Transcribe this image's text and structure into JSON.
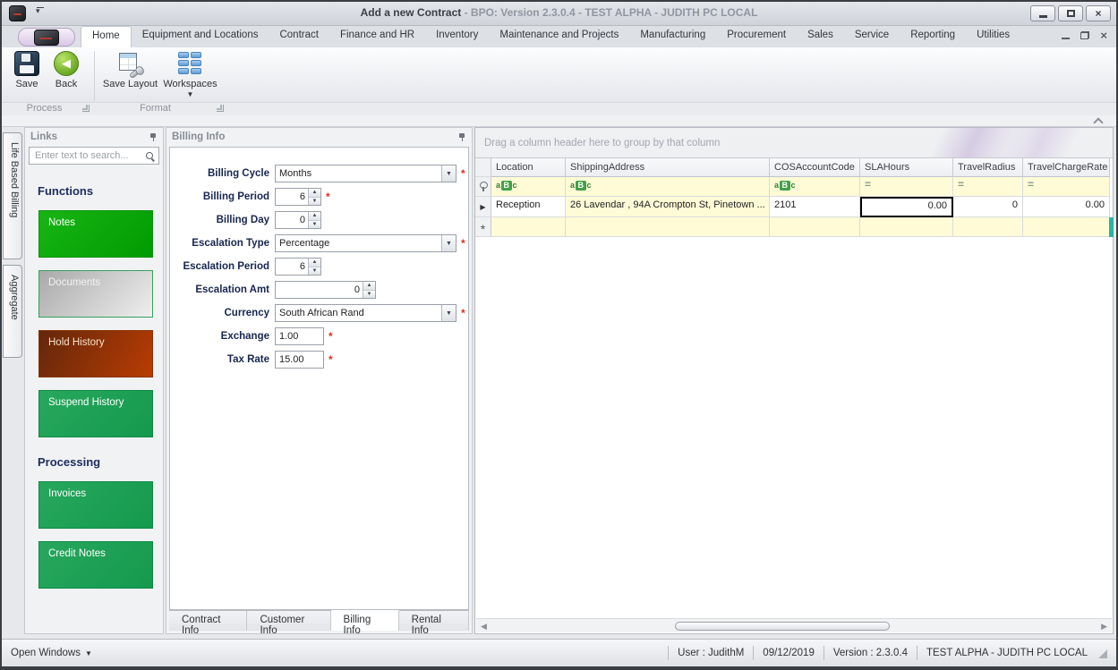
{
  "window": {
    "title_active": "Add a new Contract",
    "title_rest": " - BPO: Version 2.3.0.4 - TEST ALPHA - JUDITH PC LOCAL"
  },
  "ribbon": {
    "tabs": [
      {
        "label": "Home",
        "active": true
      },
      {
        "label": "Equipment and Locations",
        "active": false
      },
      {
        "label": "Contract",
        "active": false
      },
      {
        "label": "Finance and HR",
        "active": false
      },
      {
        "label": "Inventory",
        "active": false
      },
      {
        "label": "Maintenance and Projects",
        "active": false
      },
      {
        "label": "Manufacturing",
        "active": false
      },
      {
        "label": "Procurement",
        "active": false
      },
      {
        "label": "Sales",
        "active": false
      },
      {
        "label": "Service",
        "active": false
      },
      {
        "label": "Reporting",
        "active": false
      },
      {
        "label": "Utilities",
        "active": false
      }
    ],
    "buttons": {
      "save": "Save",
      "back": "Back",
      "save_layout": "Save Layout",
      "workspaces": "Workspaces"
    },
    "groups": {
      "process": "Process",
      "format": "Format"
    }
  },
  "side_tabs": [
    "Life Based Billing",
    "Aggregate"
  ],
  "links_panel": {
    "title": "Links",
    "search_placeholder": "Enter text to search...",
    "sections": [
      {
        "heading": "Functions",
        "buttons": [
          {
            "label": "Notes",
            "style": "green"
          },
          {
            "label": "Documents",
            "style": "disabled"
          },
          {
            "label": "Hold History",
            "style": "red"
          },
          {
            "label": "Suspend History",
            "style": "emerald"
          }
        ]
      },
      {
        "heading": "Processing",
        "buttons": [
          {
            "label": "Invoices",
            "style": "emerald"
          },
          {
            "label": "Credit Notes",
            "style": "emerald"
          }
        ]
      }
    ]
  },
  "form_panel": {
    "title": "Billing Info",
    "fields": [
      {
        "label": "Billing Cycle",
        "type": "combo",
        "value": "Months",
        "required": true
      },
      {
        "label": "Billing Period",
        "type": "spin",
        "value": "6",
        "required": true
      },
      {
        "label": "Billing Day",
        "type": "spin",
        "value": "0",
        "required": false
      },
      {
        "label": "Escalation Type",
        "type": "combo",
        "value": "Percentage",
        "required": true
      },
      {
        "label": "Escalation Period",
        "type": "spin",
        "value": "6",
        "required": false
      },
      {
        "label": "Escalation Amt",
        "type": "spin-wide",
        "value": "0",
        "required": false
      },
      {
        "label": "Currency",
        "type": "combo",
        "value": "South African Rand",
        "required": true
      },
      {
        "label": "Exchange",
        "type": "text",
        "value": "1.00",
        "required": true
      },
      {
        "label": "Tax Rate",
        "type": "text",
        "value": "15.00",
        "required": true
      }
    ],
    "tabs": [
      {
        "label": "Contract Info",
        "active": false
      },
      {
        "label": "Customer Info",
        "active": false
      },
      {
        "label": "Billing Info",
        "active": true
      },
      {
        "label": "Rental Info",
        "active": false
      }
    ]
  },
  "grid": {
    "group_hint": "Drag a column header here to group by that column",
    "columns": [
      {
        "name": "Location",
        "filter_icon": "abc",
        "align": "left"
      },
      {
        "name": "ShippingAddress",
        "filter_icon": "abc",
        "align": "left"
      },
      {
        "name": "COSAccountCode",
        "filter_icon": "abc",
        "align": "left"
      },
      {
        "name": "SLAHours",
        "filter_icon": "equals",
        "align": "right"
      },
      {
        "name": "TravelRadius",
        "filter_icon": "equals",
        "align": "right"
      },
      {
        "name": "TravelChargeRate",
        "filter_icon": "equals",
        "align": "right"
      }
    ],
    "rows": [
      {
        "cells": [
          "Reception",
          "26 Lavendar , 94A Crompton St, Pinetown ...",
          "2101",
          "0.00",
          "0",
          "0.00"
        ],
        "yellow_cols": [
          1
        ]
      }
    ],
    "focused_cell": {
      "row": 0,
      "col": 3
    },
    "has_new_row": true
  },
  "status_bar": {
    "open_windows": "Open Windows",
    "user": "User : JudithM",
    "date": "09/12/2019",
    "version": "Version : 2.3.0.4",
    "environment": "TEST ALPHA - JUDITH PC LOCAL"
  },
  "colors": {
    "link_green": "#0aa80a",
    "link_emerald": "#1ba255",
    "link_red": "#a23a06",
    "filter_row_bg": "#fffbd6",
    "required_asterisk": "#e02b20",
    "new_row_marker_teal": "#2ab3a3"
  }
}
